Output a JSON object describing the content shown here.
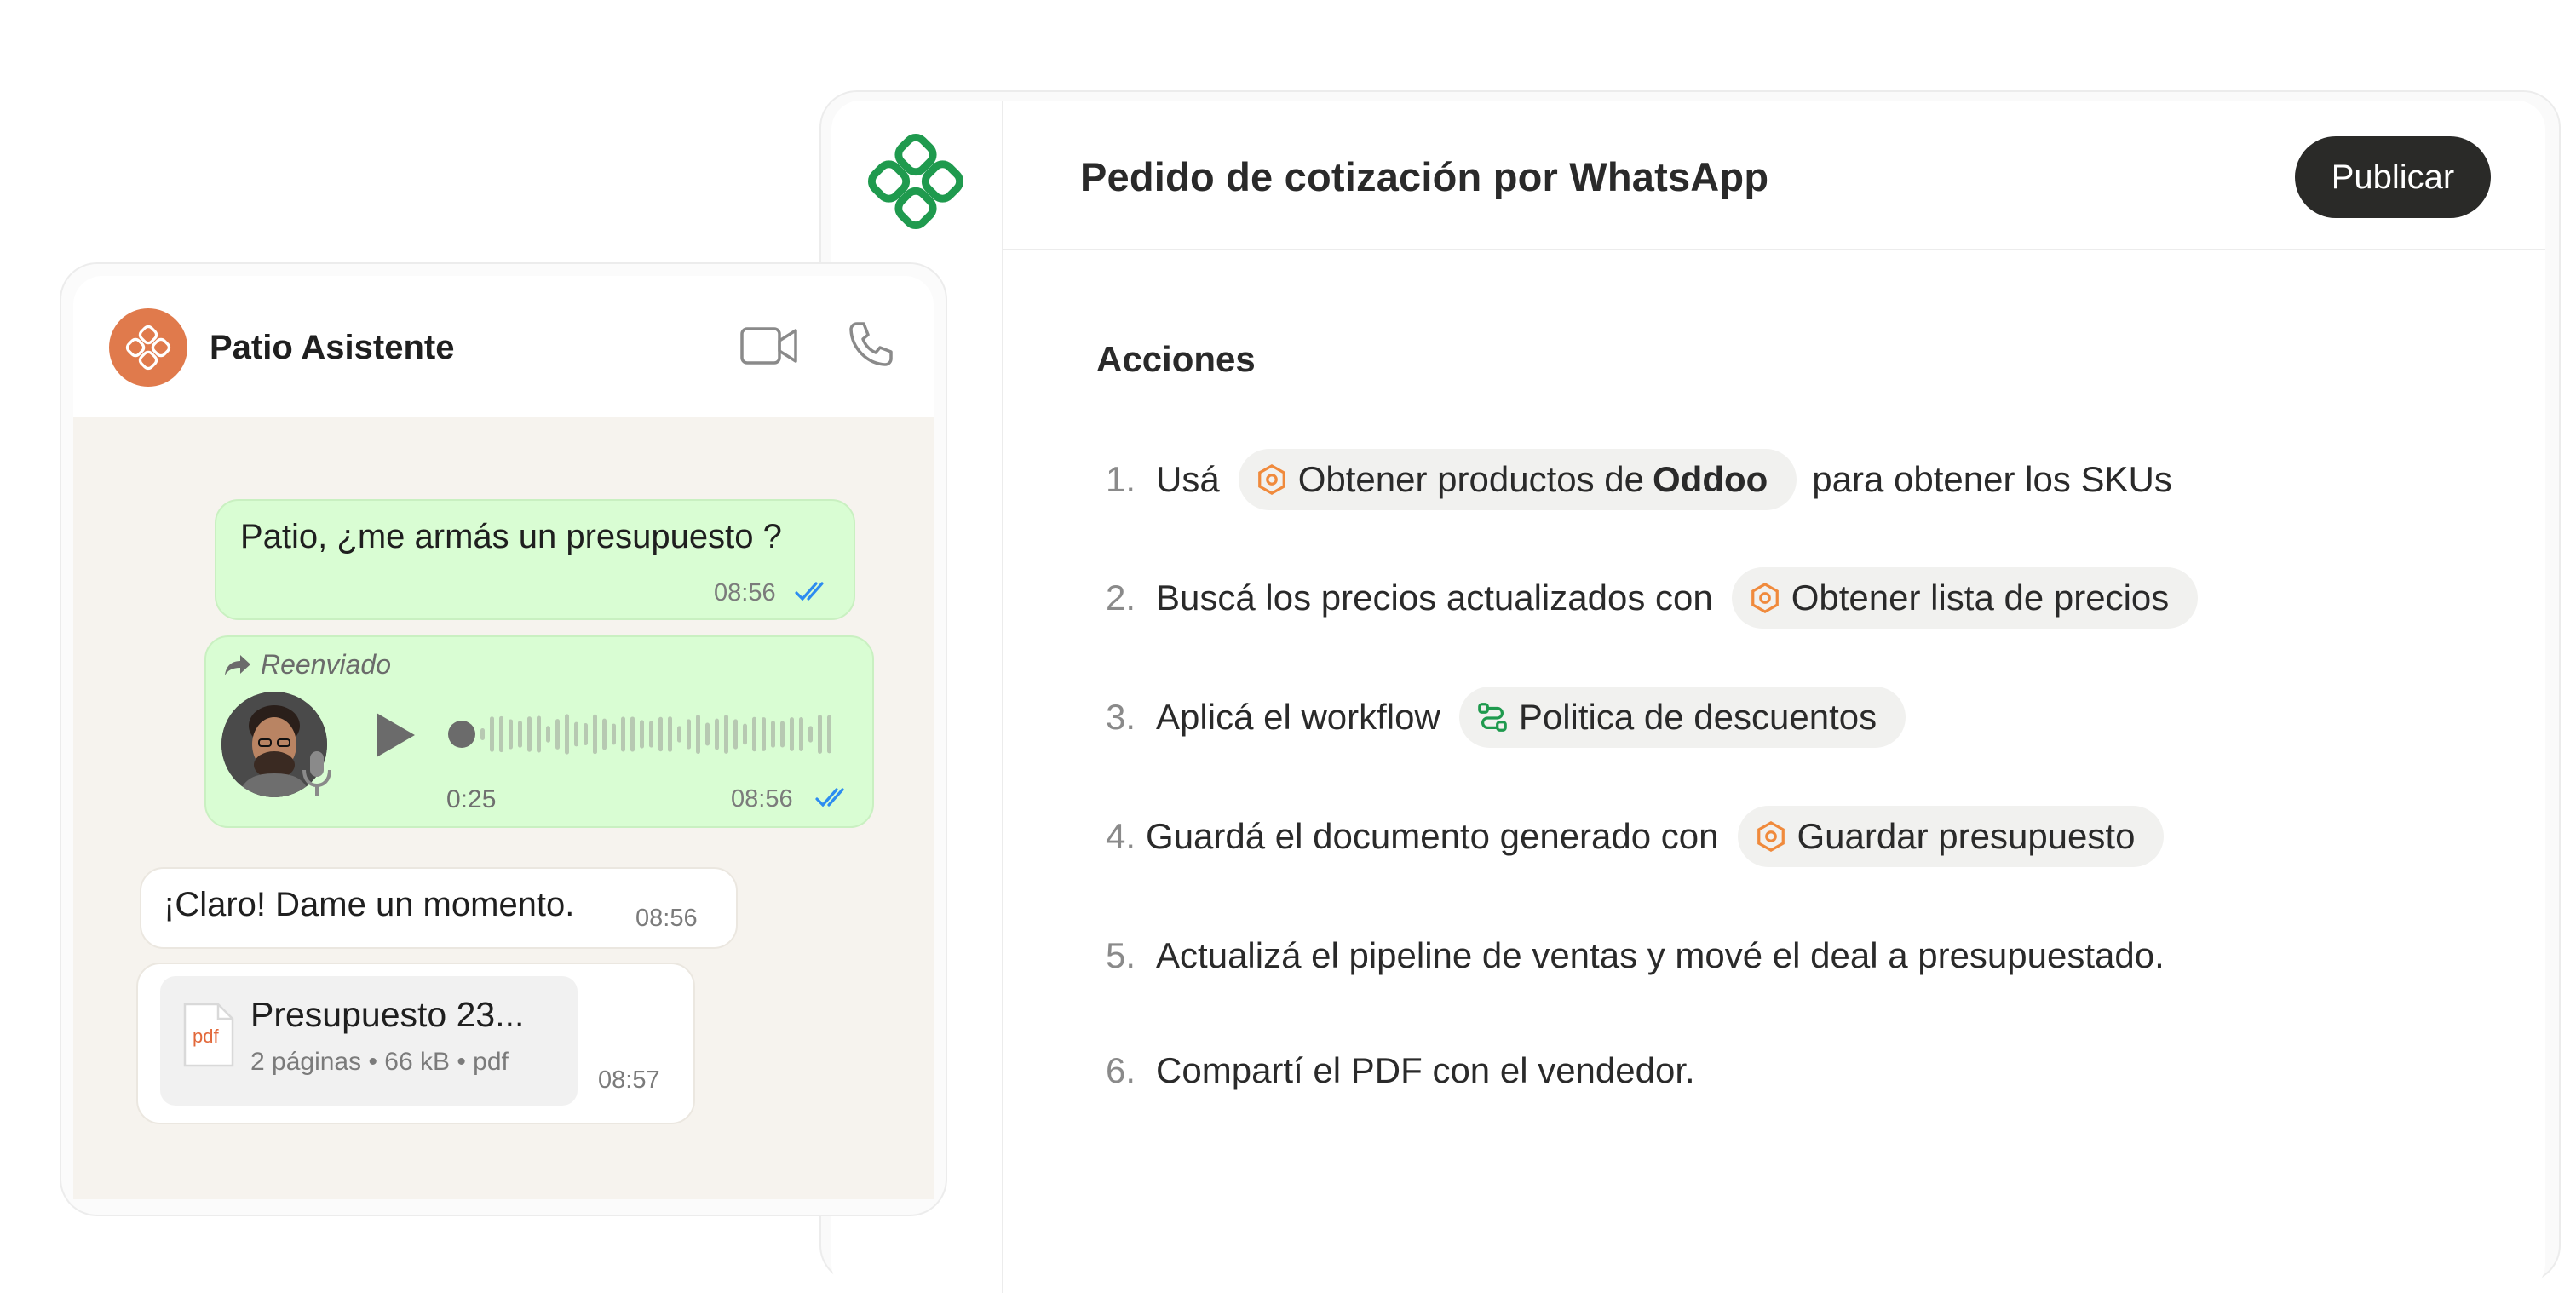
{
  "editor": {
    "title": "Pedido de cotización por WhatsApp",
    "publish_label": "Publicar",
    "section_title": "Acciones",
    "steps": [
      {
        "num": "1.",
        "text": "Usá",
        "chip": "Obtener productos de",
        "chip_strong": "Oddoo",
        "chip_icon": "hexagon-icon",
        "after": "para obtener los SKUs"
      },
      {
        "num": "2.",
        "text": "Buscá los precios actualizados con",
        "chip": "Obtener lista de precios",
        "chip_icon": "hexagon-icon"
      },
      {
        "num": "3.",
        "text": "Aplicá el workflow",
        "chip": "Politica de descuentos",
        "chip_icon": "workflow-icon"
      },
      {
        "num": "4.",
        "text": "Guardá el documento generado con",
        "chip": "Guardar presupuesto",
        "chip_icon": "hexagon-icon"
      },
      {
        "num": "5.",
        "text": "Actualizá el pipeline de ventas y mové el deal a presupuestado."
      },
      {
        "num": "6.",
        "text": "Compartí el PDF con el vendedor."
      }
    ]
  },
  "chat": {
    "contact_name": "Patio Asistente",
    "messages": {
      "m1_text": "Patio, ¿me armás un presupuesto ?",
      "m1_time": "08:56",
      "fwd_label": "Reenviado",
      "voice_duration": "0:25",
      "voice_time": "08:56",
      "m3_text": "¡Claro! Dame un momento.",
      "m3_time": "08:56",
      "doc_title": "Presupuesto 23...",
      "doc_meta": "2 páginas • 66 kB • pdf",
      "doc_badge": "pdf",
      "doc_time": "08:57"
    }
  },
  "colors": {
    "brand_green": "#1f9a4e",
    "chip_orange": "#f08a3c",
    "out_bubble": "#d9fdd3",
    "read_ticks": "#2d8cf0",
    "avatar_orange": "#e07a4c",
    "publish_button": "#2a2a28"
  }
}
